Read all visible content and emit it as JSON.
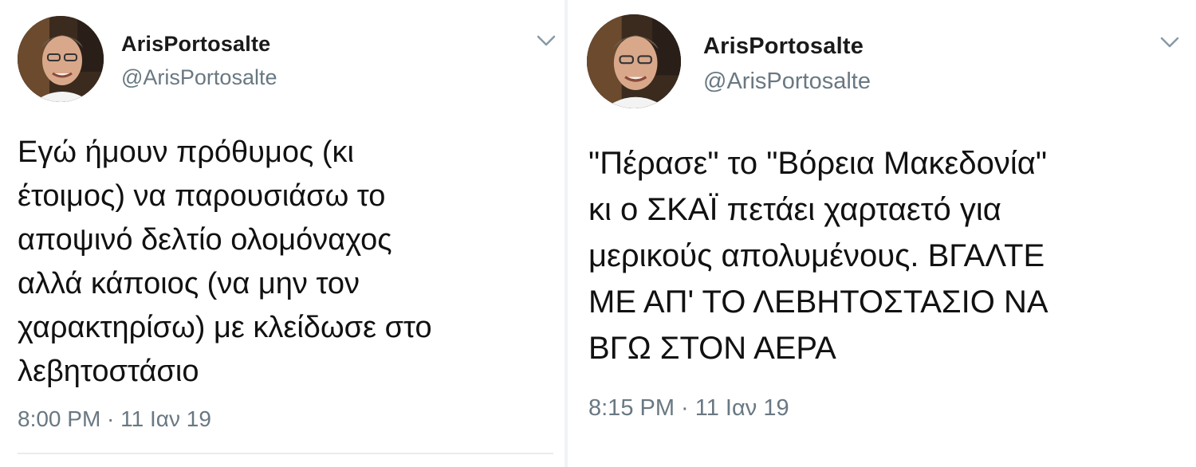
{
  "tweets": [
    {
      "display_name": "ArisPortosalte",
      "handle": "@ArisPortosalte",
      "text": "Εγώ ήμουν πρόθυμος (κι\nέτοιμος) να παρουσιάσω το\nαποψινό δελτίο ολομόναχος\nαλλά κάποιος (να μην τον\nχαρακτηρίσω) με κλείδωσε στο\nλεβητοστάσιο",
      "timestamp": "8:00 PM · 11 Ιαν 19",
      "avatar_icon": "profile-photo",
      "menu_icon": "chevron-down-icon"
    },
    {
      "display_name": "ArisPortosalte",
      "handle": "@ArisPortosalte",
      "text": "\"Πέρασε\" το \"Βόρεια Μακεδονία\"\nκι ο ΣΚΑΪ πετάει χαρταετό για\nμερικούς απολυμένους. ΒΓΑΛΤΕ\nΜΕ ΑΠ' ΤΟ ΛΕΒΗΤΟΣΤΑΣΙΟ ΝΑ\nΒΓΩ ΣΤΟΝ ΑΕΡΑ",
      "timestamp": "8:15 PM · 11 Ιαν 19",
      "avatar_icon": "profile-photo",
      "menu_icon": "chevron-down-icon"
    }
  ],
  "colors": {
    "text_primary": "#111111",
    "text_secondary": "#697882",
    "background": "#ffffff"
  }
}
